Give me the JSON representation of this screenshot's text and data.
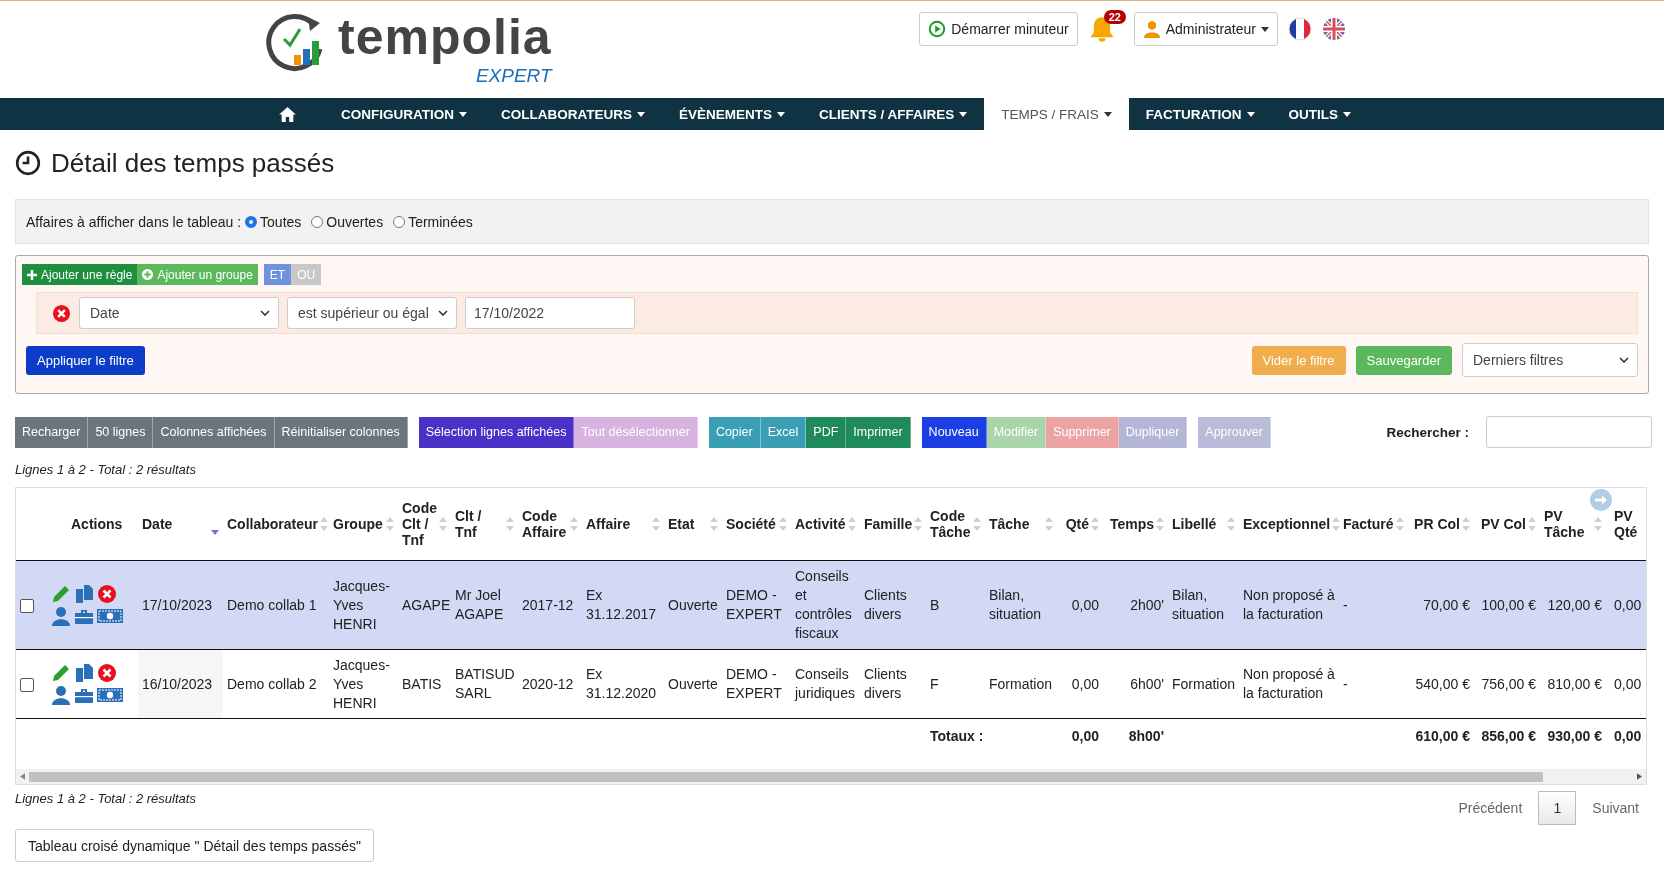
{
  "logo": {
    "name": "tempolia",
    "edition": "EXPERT"
  },
  "header": {
    "timer_button": "Démarrer minuteur",
    "notifications": "22",
    "user_menu": "Administrateur"
  },
  "nav": [
    {
      "label": "CONFIGURATION",
      "selected": false
    },
    {
      "label": "COLLABORATEURS",
      "selected": false
    },
    {
      "label": "ÉVÈNEMENTS",
      "selected": false
    },
    {
      "label": "CLIENTS / AFFAIRES",
      "selected": false
    },
    {
      "label": "TEMPS / FRAIS",
      "selected": true
    },
    {
      "label": "FACTURATION",
      "selected": false
    },
    {
      "label": "OUTILS",
      "selected": false
    }
  ],
  "page_title": "Détail des temps passés",
  "display_filter": {
    "label": "Affaires à afficher dans le tableau :",
    "options": [
      {
        "label": "Toutes",
        "selected": true
      },
      {
        "label": "Ouvertes",
        "selected": false
      },
      {
        "label": "Terminées",
        "selected": false
      }
    ]
  },
  "query_builder": {
    "add_rule": "Ajouter une règle",
    "add_group": "Ajouter un groupe",
    "conditions": [
      {
        "label": "ET",
        "selected": true
      },
      {
        "label": "OU",
        "selected": false
      }
    ],
    "rule": {
      "field": "Date",
      "operator": "est supérieur ou égal",
      "value": "17/10/2022"
    },
    "apply": "Appliquer le filtre",
    "clear": "Vider le filtre",
    "save": "Sauvegarder",
    "saved_filters": "Derniers filtres"
  },
  "toolbar": [
    [
      {
        "label": "Recharger",
        "color": "#6c757d"
      },
      {
        "label": "50 lignes",
        "color": "#6c757d"
      },
      {
        "label": "Colonnes affichées",
        "color": "#6c757d"
      },
      {
        "label": "Réinitialiser colonnes",
        "color": "#6c757d"
      }
    ],
    [
      {
        "label": "Sélection lignes affichées",
        "color": "#4a32c8"
      },
      {
        "label": "Tout désélectionner",
        "color": "#d9b3e0"
      }
    ],
    [
      {
        "label": "Copier",
        "color": "#3a9fb4"
      },
      {
        "label": "Excel",
        "color": "#3a9fb4"
      },
      {
        "label": "PDF",
        "color": "#1f8a5b"
      },
      {
        "label": "Imprimer",
        "color": "#1f8a5b"
      }
    ],
    [
      {
        "label": "Nouveau",
        "color": "#1b3fe4"
      },
      {
        "label": "Modifier",
        "color": "#a9d5a9"
      },
      {
        "label": "Supprimer",
        "color": "#eba3a3"
      },
      {
        "label": "Dupliquer",
        "color": "#b3b6d6"
      }
    ],
    [
      {
        "label": "Approuver",
        "color": "#b9bcd9"
      }
    ]
  ],
  "search": {
    "label": "Rechercher :"
  },
  "info_top": "Lignes 1 à 2 - Total : 2 résultats",
  "table": {
    "actions_header": "Actions",
    "columns": [
      {
        "label": "Date",
        "sortable": true,
        "sorted_descending": true,
        "kind": "text"
      },
      {
        "label": "Collaborateur",
        "sortable": true,
        "sorted_descending": false,
        "kind": "text"
      },
      {
        "label": "Groupe",
        "sortable": true,
        "sorted_descending": false,
        "kind": "text"
      },
      {
        "label": "Code Clt / Tnf",
        "sortable": true,
        "sorted_descending": false,
        "kind": "text"
      },
      {
        "label": "Clt / Tnf",
        "sortable": true,
        "sorted_descending": false,
        "kind": "text"
      },
      {
        "label": "Code Affaire",
        "sortable": true,
        "sorted_descending": false,
        "kind": "text"
      },
      {
        "label": "Affaire",
        "sortable": true,
        "sorted_descending": false,
        "kind": "text"
      },
      {
        "label": "Etat",
        "sortable": true,
        "sorted_descending": false,
        "kind": "text"
      },
      {
        "label": "Société",
        "sortable": true,
        "sorted_descending": false,
        "kind": "text"
      },
      {
        "label": "Activité",
        "sortable": true,
        "sorted_descending": false,
        "kind": "text"
      },
      {
        "label": "Famille",
        "sortable": true,
        "sorted_descending": false,
        "kind": "text"
      },
      {
        "label": "Code Tâche",
        "sortable": true,
        "sorted_descending": false,
        "kind": "text"
      },
      {
        "label": "Tâche",
        "sortable": true,
        "sorted_descending": false,
        "kind": "text"
      },
      {
        "label": "Qté",
        "sortable": true,
        "sorted_descending": false,
        "kind": "number"
      },
      {
        "label": "Temps",
        "sortable": true,
        "sorted_descending": false,
        "kind": "number"
      },
      {
        "label": "Libellé",
        "sortable": true,
        "sorted_descending": false,
        "kind": "text"
      },
      {
        "label": "Exceptionnel",
        "sortable": true,
        "sorted_descending": false,
        "kind": "text"
      },
      {
        "label": "Facturé",
        "sortable": true,
        "sorted_descending": false,
        "kind": "text"
      },
      {
        "label": "PR Col",
        "sortable": true,
        "sorted_descending": false,
        "kind": "number"
      },
      {
        "label": "PV Col",
        "sortable": true,
        "sorted_descending": false,
        "kind": "number"
      },
      {
        "label": "PV Tâche",
        "sortable": true,
        "sorted_descending": false,
        "kind": "number"
      },
      {
        "label": "PV Qté",
        "sortable": false,
        "kind": "text"
      }
    ],
    "rows": [
      {
        "selected": true,
        "checked": false,
        "cells": [
          "17/10/2023",
          "Demo collab 1",
          "Jacques-Yves HENRI",
          "AGAPE",
          "Mr Joel AGAPE",
          "2017-12",
          "Ex 31.12.2017",
          "Ouverte",
          "DEMO - EXPERT",
          "Conseils et contrôles fiscaux",
          "Clients divers",
          "B",
          "Bilan, situation",
          "0,00",
          "2h00'",
          "Bilan, situation",
          "Non proposé à la facturation",
          "-",
          "70,00 €",
          "100,00 €",
          "120,00 €",
          "0,00"
        ]
      },
      {
        "selected": false,
        "checked": false,
        "cells": [
          "16/10/2023",
          "Demo collab 2",
          "Jacques-Yves HENRI",
          "BATIS",
          "BATISUD SARL",
          "2020-12",
          "Ex 31.12.2020",
          "Ouverte",
          "DEMO - EXPERT",
          "Conseils juridiques",
          "Clients divers",
          "F",
          "Formation",
          "0,00",
          "6h00'",
          "Formation",
          "Non proposé à la facturation",
          "-",
          "540,00 €",
          "756,00 €",
          "810,00 €",
          "0,00"
        ]
      }
    ],
    "totals": {
      "label": "Totaux :",
      "qty": "0,00",
      "time": "8h00'",
      "pr_col": "610,00 €",
      "pv_col": "856,00 €",
      "pv_task": "930,00 €",
      "pv_qty": "0,00"
    }
  },
  "info_bottom": "Lignes 1 à 2 - Total : 2 résultats",
  "pagination": {
    "previous": "Précédent",
    "pages": [
      {
        "label": "1",
        "selected": true
      }
    ],
    "next": "Suivant"
  },
  "pivot_button": "Tableau croisé dynamique \" Détail des temps passés\""
}
